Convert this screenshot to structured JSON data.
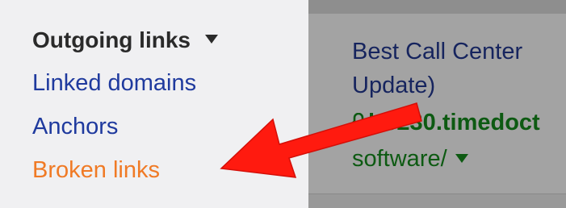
{
  "sidebar": {
    "section_title": "Outgoing links",
    "items": [
      {
        "label": "Linked domains",
        "active": false
      },
      {
        "label": "Anchors",
        "active": false
      },
      {
        "label": "Broken links",
        "active": true
      }
    ]
  },
  "content": {
    "result_title": "Best Call Center Update)",
    "result_url": "bb230.timedoct",
    "result_path": "software/"
  },
  "annotation": {
    "arrow_color": "#ff1a0f",
    "points_to": "Broken links"
  },
  "colors": {
    "link_blue": "#1f3a9e",
    "active_orange": "#f07a25",
    "url_green": "#0d5a12",
    "overlay_gray": "#a3a3a3"
  }
}
